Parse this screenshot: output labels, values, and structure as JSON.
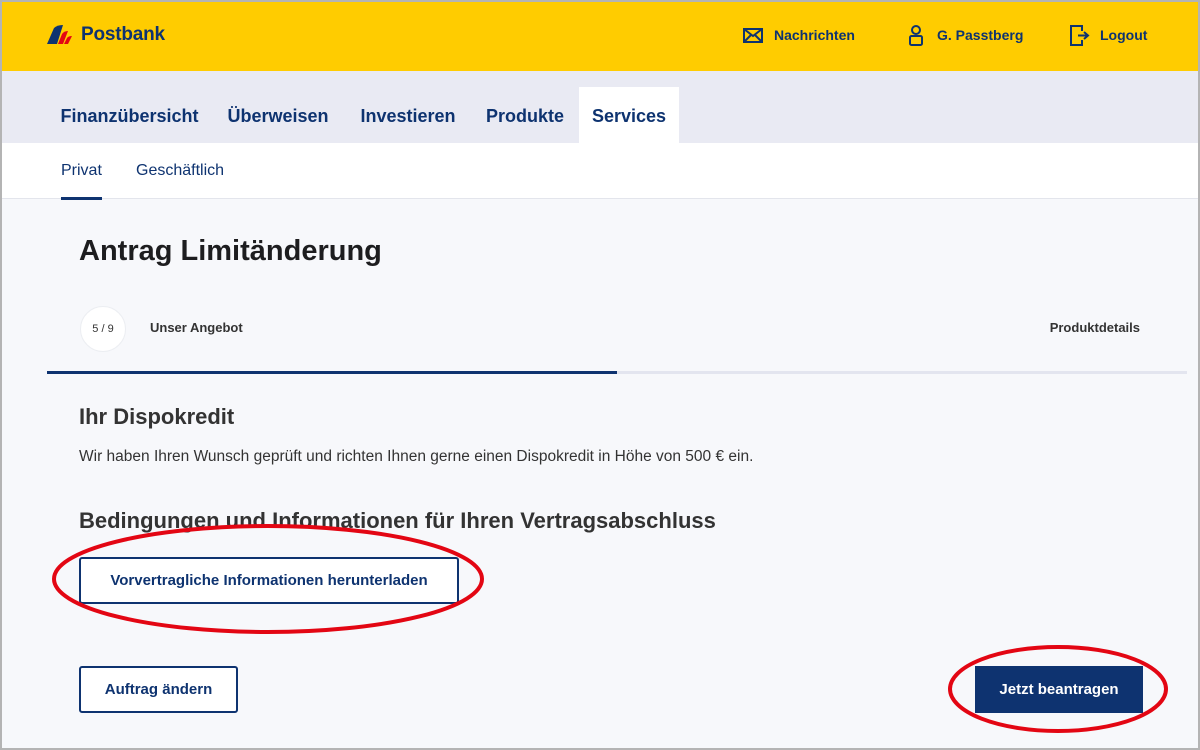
{
  "brand": {
    "name": "Postbank",
    "primary_color": "#ffcc00",
    "accent_color": "#0e3370",
    "logo_red": "#e30613"
  },
  "top_actions": [
    {
      "icon": "mail-icon",
      "label": "Nachrichten"
    },
    {
      "icon": "user-icon",
      "label": "G. Passtberg"
    },
    {
      "icon": "logout-icon",
      "label": "Logout"
    }
  ],
  "main_nav": [
    {
      "label": "Finanzübersicht",
      "active": false
    },
    {
      "label": "Überweisen",
      "active": false
    },
    {
      "label": "Investieren",
      "active": false
    },
    {
      "label": "Produkte",
      "active": false
    },
    {
      "label": "Services",
      "active": true
    }
  ],
  "sub_nav": [
    {
      "label": "Privat",
      "active": true
    },
    {
      "label": "Geschäftlich",
      "active": false
    }
  ],
  "page": {
    "title": "Antrag Limitänderung",
    "step": {
      "indicator": "5 / 9",
      "current_label": "Unser Angebot",
      "next_label": "Produktdetails",
      "progress_fraction": 0.5
    },
    "section1": {
      "heading": "Ihr Dispokredit",
      "text": "Wir haben Ihren Wunsch geprüft und richten Ihnen gerne einen Dispokredit in Höhe von 500 € ein."
    },
    "section2": {
      "heading": "Bedingungen und Informationen für Ihren Vertragsabschluss",
      "download_button": "Vorvertragliche Informationen herunterladen"
    },
    "buttons": {
      "change": "Auftrag ändern",
      "submit": "Jetzt beantragen"
    }
  },
  "annotations": {
    "highlight_color": "#e30613"
  }
}
